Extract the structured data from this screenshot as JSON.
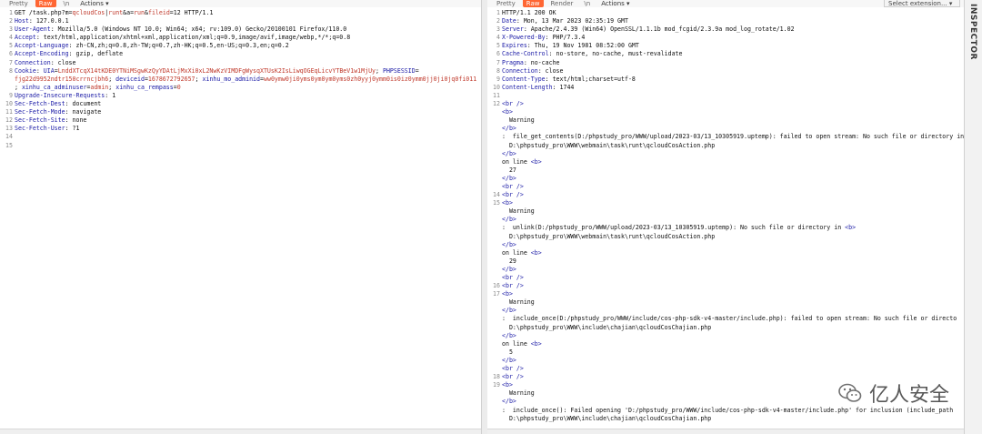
{
  "request": {
    "tabs": [
      "Pretty",
      "Raw",
      "\\n",
      "Actions ▾"
    ],
    "active_tab": 1,
    "lines": [
      [
        {
          "t": "GET /task.php?m="
        },
        {
          "t": "qcloudCos",
          "c": "rd"
        },
        {
          "t": "|"
        },
        {
          "t": "runt",
          "c": "rd"
        },
        {
          "t": "&a="
        },
        {
          "t": "run",
          "c": "rd"
        },
        {
          "t": "&"
        },
        {
          "t": "fileid",
          "c": "rd"
        },
        {
          "t": "=12 HTTP/1.1"
        }
      ],
      [
        {
          "t": "Host",
          "c": "hn"
        },
        {
          "t": ": 127.0.0.1"
        }
      ],
      [
        {
          "t": "User-Agent",
          "c": "hn"
        },
        {
          "t": ": Mozilla/5.0 (Windows NT 10.0; Win64; x64; rv:109.0) Gecko/20100101 Firefox/110.0"
        }
      ],
      [
        {
          "t": "Accept",
          "c": "hn"
        },
        {
          "t": ": text/html,application/xhtml+xml,application/xml;q=0.9,image/avif,image/webp,*/*;q=0.8"
        }
      ],
      [
        {
          "t": "Accept-Language",
          "c": "hn"
        },
        {
          "t": ": zh-CN,zh;q=0.8,zh-TW;q=0.7,zh-HK;q=0.5,en-US;q=0.3,en;q=0.2"
        }
      ],
      [
        {
          "t": "Accept-Encoding",
          "c": "hn"
        },
        {
          "t": ": gzip, deflate"
        }
      ],
      [
        {
          "t": "Connection",
          "c": "hn"
        },
        {
          "t": ": close"
        }
      ],
      [
        {
          "t": "Cookie",
          "c": "hn"
        },
        {
          "t": ": "
        },
        {
          "t": "UIA",
          "c": "bl"
        },
        {
          "t": "="
        },
        {
          "t": "LnddXTcqX14tKDE0YTNiMSgwKzQyYDAtLjMxXi0xL2NwKzVIMDFgWysqXTUsK2IsLiwqOGEqLicvYTBeV1w1MjUy",
          "c": "rd"
        },
        {
          "t": "; "
        },
        {
          "t": "PHPSESSID",
          "c": "bl"
        },
        {
          "t": "="
        }
      ],
      {
        "cont": true,
        "segs": [
          {
            "t": "fjg22d9952ndtr150crrncjbh6",
            "c": "rd"
          },
          {
            "t": "; "
          },
          {
            "t": "deviceid",
            "c": "bl"
          },
          {
            "t": "="
          },
          {
            "t": "1678672792657",
            "c": "rd"
          },
          {
            "t": "; "
          },
          {
            "t": "xinhu_mo_adminid",
            "c": "bl"
          },
          {
            "t": "="
          },
          {
            "t": "ww0ymw0ji0yms0ym0ym0yms0zh0yyj0ymm0is0iz0ymm0jj0ji0jq0fi011",
            "c": "rd"
          }
        ]
      },
      {
        "cont": true,
        "segs": [
          {
            "t": "; "
          },
          {
            "t": "xinhu_ca_adminuser",
            "c": "bl"
          },
          {
            "t": "="
          },
          {
            "t": "admin",
            "c": "rd"
          },
          {
            "t": "; "
          },
          {
            "t": "xinhu_ca_rempass",
            "c": "bl"
          },
          {
            "t": "="
          },
          {
            "t": "0",
            "c": "rd"
          }
        ]
      },
      [
        {
          "t": "Upgrade-Insecure-Requests",
          "c": "hn"
        },
        {
          "t": ": 1"
        }
      ],
      [
        {
          "t": "Sec-Fetch-Dest",
          "c": "hn"
        },
        {
          "t": ": document"
        }
      ],
      [
        {
          "t": "Sec-Fetch-Mode",
          "c": "hn"
        },
        {
          "t": ": navigate"
        }
      ],
      [
        {
          "t": "Sec-Fetch-Site",
          "c": "hn"
        },
        {
          "t": ": none"
        }
      ],
      [
        {
          "t": "Sec-Fetch-User",
          "c": "hn"
        },
        {
          "t": ": ?1"
        }
      ],
      [],
      []
    ]
  },
  "response": {
    "tabs": [
      "Pretty",
      "Raw",
      "Render",
      "\\n",
      "Actions ▾"
    ],
    "active_tab": 1,
    "extension_select": "Select extension... ▾",
    "lines": [
      {
        "n": "1",
        "segs": [
          {
            "t": "HTTP/1.1 200 OK"
          }
        ]
      },
      {
        "n": "2",
        "segs": [
          {
            "t": "Date",
            "c": "hn"
          },
          {
            "t": ": Mon, 13 Mar 2023 02:35:19 GMT"
          }
        ]
      },
      {
        "n": "3",
        "segs": [
          {
            "t": "Server",
            "c": "hn"
          },
          {
            "t": ": Apache/2.4.39 (Win64) OpenSSL/1.1.1b mod_fcgid/2.3.9a mod_log_rotate/1.02"
          }
        ]
      },
      {
        "n": "4",
        "segs": [
          {
            "t": "X-Powered-By",
            "c": "hn"
          },
          {
            "t": ": PHP/7.3.4"
          }
        ]
      },
      {
        "n": "5",
        "segs": [
          {
            "t": "Expires",
            "c": "hn"
          },
          {
            "t": ": Thu, 19 Nov 1981 08:52:00 GMT"
          }
        ]
      },
      {
        "n": "6",
        "segs": [
          {
            "t": "Cache-Control",
            "c": "hn"
          },
          {
            "t": ": no-store, no-cache, must-revalidate"
          }
        ]
      },
      {
        "n": "7",
        "segs": [
          {
            "t": "Pragma",
            "c": "hn"
          },
          {
            "t": ": no-cache"
          }
        ]
      },
      {
        "n": "8",
        "segs": [
          {
            "t": "Connection",
            "c": "hn"
          },
          {
            "t": ": close"
          }
        ]
      },
      {
        "n": "9",
        "segs": [
          {
            "t": "Content-Type",
            "c": "hn"
          },
          {
            "t": ": text/html;charset=utf-8"
          }
        ]
      },
      {
        "n": "10",
        "segs": [
          {
            "t": "Content-Length",
            "c": "hn"
          },
          {
            "t": ": 1744"
          }
        ]
      },
      {
        "n": "11",
        "segs": []
      },
      {
        "n": "12",
        "segs": [
          {
            "t": "<br />",
            "c": "tagc"
          }
        ]
      },
      {
        "n": "",
        "segs": [
          {
            "t": "<b>",
            "c": "tagc"
          }
        ]
      },
      {
        "n": "",
        "segs": [
          {
            "t": "  Warning"
          }
        ]
      },
      {
        "n": "",
        "segs": [
          {
            "t": "</b>",
            "c": "tagc"
          }
        ]
      },
      {
        "n": "",
        "segs": [
          {
            "t": ":  file_get_contents(D:/phpstudy_pro/WWW/upload/2023-03/13_10305919.uptemp): failed to open stream: No such file or directory in "
          },
          {
            "t": "<b>",
            "c": "tagc"
          }
        ]
      },
      {
        "n": "",
        "segs": [
          {
            "t": "  D:\\phpstudy_pro\\WWW\\webmain\\task\\runt\\qcloudCosAction.php"
          }
        ]
      },
      {
        "n": "",
        "segs": [
          {
            "t": "</b>",
            "c": "tagc"
          }
        ]
      },
      {
        "n": "",
        "segs": [
          {
            "t": "on line "
          },
          {
            "t": "<b>",
            "c": "tagc"
          }
        ]
      },
      {
        "n": "",
        "segs": [
          {
            "t": "  27"
          }
        ]
      },
      {
        "n": "",
        "segs": [
          {
            "t": "</b>",
            "c": "tagc"
          }
        ]
      },
      {
        "n": "",
        "segs": [
          {
            "t": "<br />",
            "c": "tagc"
          }
        ]
      },
      {
        "n": "14",
        "segs": [
          {
            "t": "<br />",
            "c": "tagc"
          }
        ]
      },
      {
        "n": "15",
        "segs": [
          {
            "t": "<b>",
            "c": "tagc"
          }
        ]
      },
      {
        "n": "",
        "segs": [
          {
            "t": "  Warning"
          }
        ]
      },
      {
        "n": "",
        "segs": [
          {
            "t": "</b>",
            "c": "tagc"
          }
        ]
      },
      {
        "n": "",
        "segs": [
          {
            "t": ":  unlink(D:/phpstudy_pro/WWW/upload/2023-03/13_10305919.uptemp): No such file or directory in "
          },
          {
            "t": "<b>",
            "c": "tagc"
          }
        ]
      },
      {
        "n": "",
        "segs": [
          {
            "t": "  D:\\phpstudy_pro\\WWW\\webmain\\task\\runt\\qcloudCosAction.php"
          }
        ]
      },
      {
        "n": "",
        "segs": [
          {
            "t": "</b>",
            "c": "tagc"
          }
        ]
      },
      {
        "n": "",
        "segs": [
          {
            "t": "on line "
          },
          {
            "t": "<b>",
            "c": "tagc"
          }
        ]
      },
      {
        "n": "",
        "segs": [
          {
            "t": "  29"
          }
        ]
      },
      {
        "n": "",
        "segs": [
          {
            "t": "</b>",
            "c": "tagc"
          }
        ]
      },
      {
        "n": "",
        "segs": [
          {
            "t": "<br />",
            "c": "tagc"
          }
        ]
      },
      {
        "n": "16",
        "segs": [
          {
            "t": "<br />",
            "c": "tagc"
          }
        ]
      },
      {
        "n": "17",
        "segs": [
          {
            "t": "<b>",
            "c": "tagc"
          }
        ]
      },
      {
        "n": "",
        "segs": [
          {
            "t": "  Warning"
          }
        ]
      },
      {
        "n": "",
        "segs": [
          {
            "t": "</b>",
            "c": "tagc"
          }
        ]
      },
      {
        "n": "",
        "segs": [
          {
            "t": ":  include_once(D:/phpstudy_pro/WWW/include/cos-php-sdk-v4-master/include.php): failed to open stream: No such file or directo"
          }
        ]
      },
      {
        "n": "",
        "segs": [
          {
            "t": "  D:\\phpstudy_pro\\WWW\\include\\chajian\\qcloudCosChajian.php"
          }
        ]
      },
      {
        "n": "",
        "segs": [
          {
            "t": "</b>",
            "c": "tagc"
          }
        ]
      },
      {
        "n": "",
        "segs": [
          {
            "t": "on line "
          },
          {
            "t": "<b>",
            "c": "tagc"
          }
        ]
      },
      {
        "n": "",
        "segs": [
          {
            "t": "  5"
          }
        ]
      },
      {
        "n": "",
        "segs": [
          {
            "t": "</b>",
            "c": "tagc"
          }
        ]
      },
      {
        "n": "",
        "segs": [
          {
            "t": "<br />",
            "c": "tagc"
          }
        ]
      },
      {
        "n": "18",
        "segs": [
          {
            "t": "<br />",
            "c": "tagc"
          }
        ]
      },
      {
        "n": "19",
        "segs": [
          {
            "t": "<b>",
            "c": "tagc"
          }
        ]
      },
      {
        "n": "",
        "segs": [
          {
            "t": "  Warning"
          }
        ]
      },
      {
        "n": "",
        "segs": [
          {
            "t": "</b>",
            "c": "tagc"
          }
        ]
      },
      {
        "n": "",
        "segs": [
          {
            "t": ":  include_once(): Failed opening 'D:/phpstudy_pro/WWW/include/cos-php-sdk-v4-master/include.php' for inclusion (include_path"
          }
        ]
      },
      {
        "n": "",
        "segs": [
          {
            "t": "  D:\\phpstudy_pro\\WWW\\include\\chajian\\qcloudCosChajian.php"
          }
        ]
      }
    ]
  },
  "sidebar": {
    "label": "INSPECTOR"
  },
  "watermark": {
    "text": "亿人安全"
  }
}
